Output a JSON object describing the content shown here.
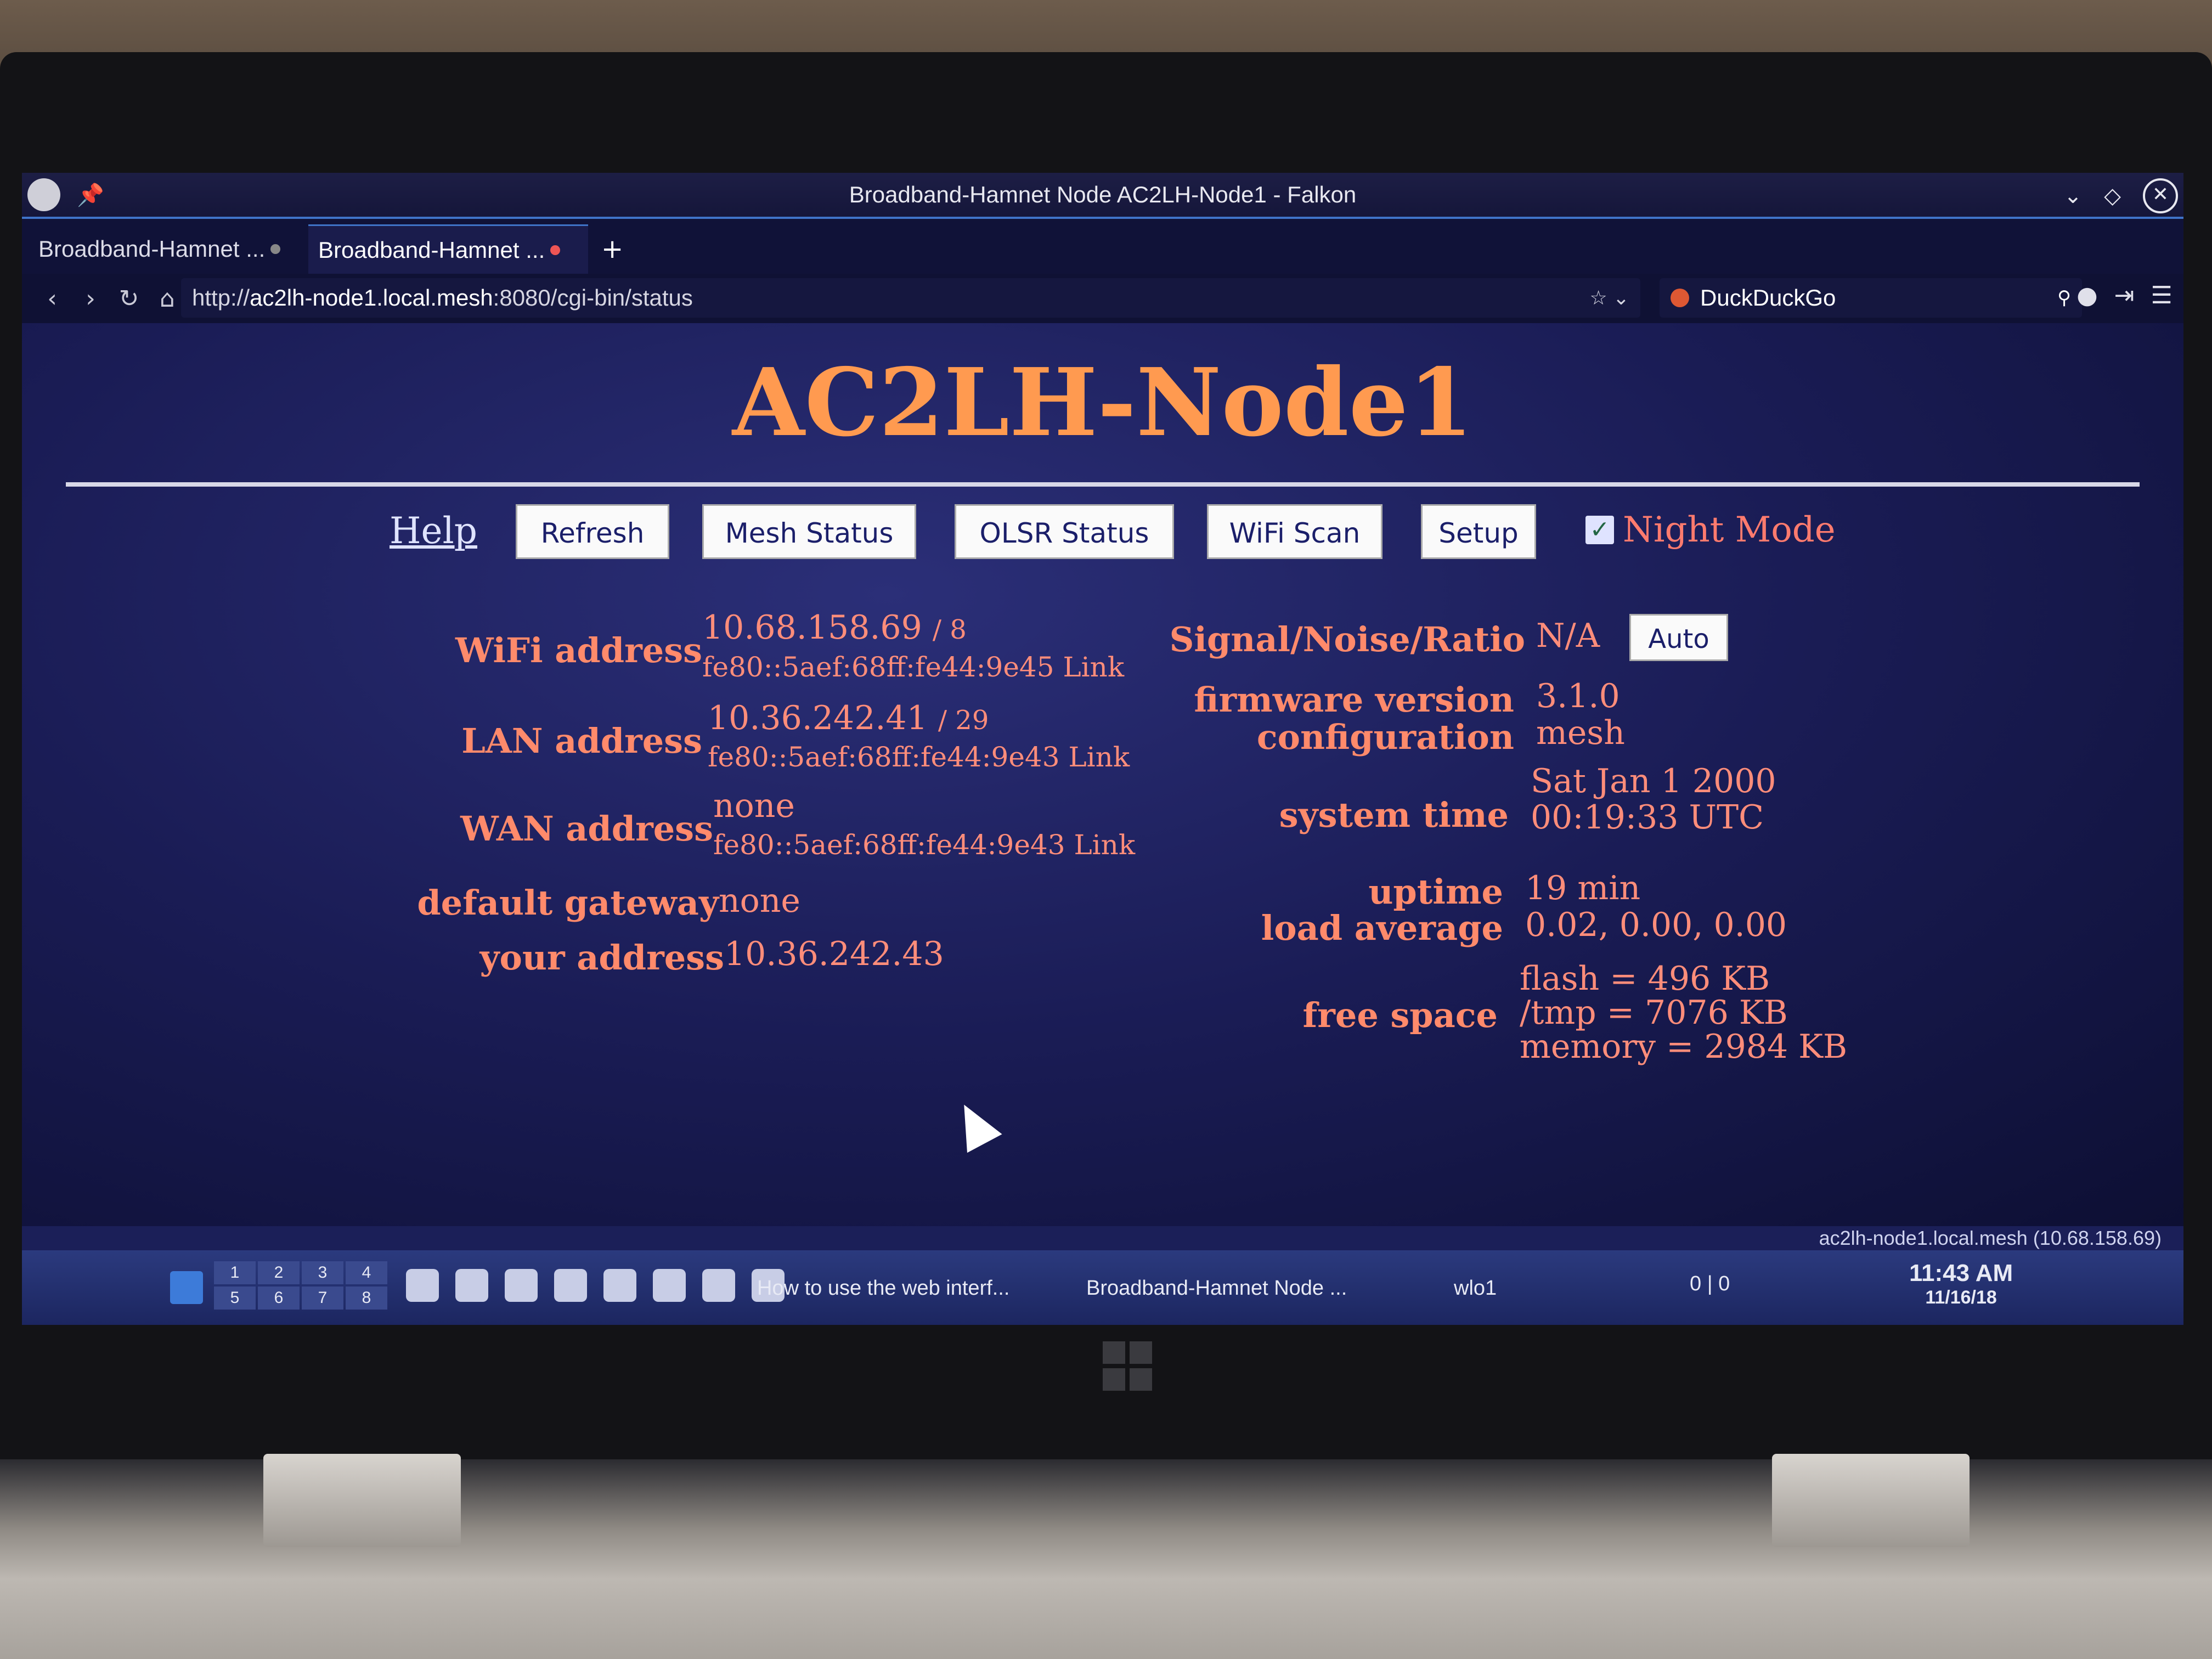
{
  "window": {
    "title": "Broadband-Hamnet Node AC2LH-Node1 - Falkon"
  },
  "tabs": [
    {
      "label": "Broadband-Hamnet ..."
    },
    {
      "label": "Broadband-Hamnet ..."
    }
  ],
  "navbar": {
    "url_prefix": "http://",
    "url_host": "ac2lh-node1.local.mesh",
    "url_rest": ":8080/cgi-bin/status",
    "search_engine": "DuckDuckGo"
  },
  "page": {
    "node_name": "AC2LH-Node1",
    "menu": {
      "help": "Help",
      "refresh": "Refresh",
      "mesh_status": "Mesh Status",
      "olsr_status": "OLSR Status",
      "wifi_scan": "WiFi Scan",
      "setup": "Setup",
      "night_mode": "Night Mode",
      "night_mode_checked": true
    },
    "left": {
      "wifi_label": "WiFi address",
      "wifi_ip": "10.68.158.69",
      "wifi_mask": "/ 8",
      "wifi_link": "fe80::5aef:68ff:fe44:9e45 Link",
      "lan_label": "LAN address",
      "lan_ip": "10.36.242.41",
      "lan_mask": "/ 29",
      "lan_link": "fe80::5aef:68ff:fe44:9e43 Link",
      "wan_label": "WAN address",
      "wan_ip": "none",
      "wan_link": "fe80::5aef:68ff:fe44:9e43 Link",
      "gateway_label": "default gateway",
      "gateway_value": "none",
      "your_label": "your address",
      "your_value": "10.36.242.43"
    },
    "right": {
      "snr_label": "Signal/Noise/Ratio",
      "snr_value": "N/A",
      "auto_button": "Auto",
      "firmware_label": "firmware version",
      "firmware_value": "3.1.0",
      "config_label": "configuration",
      "config_value": "mesh",
      "time_label": "system time",
      "time_line1": "Sat Jan 1 2000",
      "time_line2": "00:19:33 UTC",
      "uptime_label": "uptime",
      "uptime_value": "19 min",
      "load_label": "load average",
      "load_value": "0.02, 0.00, 0.00",
      "free_label": "free space",
      "flash_value": "flash = 496 KB",
      "tmp_value": "/tmp = 7076 KB",
      "memory_value": "memory = 2984 KB"
    }
  },
  "statusbar": {
    "text": "ac2lh-node1.local.mesh (10.68.158.69)"
  },
  "taskbar": {
    "pager": [
      "1",
      "2",
      "3",
      "4",
      "5",
      "6",
      "7",
      "8"
    ],
    "task1": "How to use the web interf...",
    "task2": "Broadband-Hamnet Node ...",
    "network": "wlo1",
    "tray_counts": "0 | 0",
    "clock_time": "11:43 AM",
    "clock_date": "11/16/18"
  }
}
